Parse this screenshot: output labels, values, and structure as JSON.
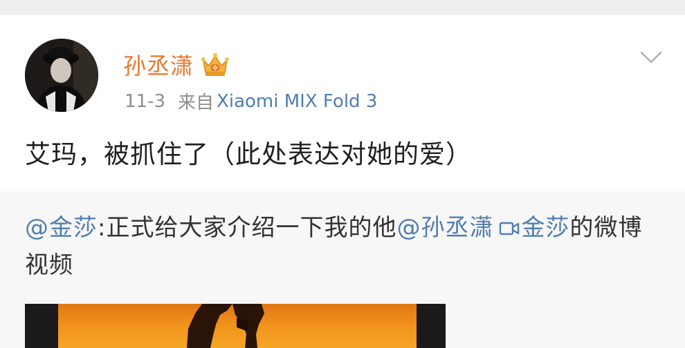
{
  "post": {
    "username": "孙丞潇",
    "time": "11-3",
    "from_label": "来自",
    "device": "Xiaomi MIX Fold 3",
    "text": "艾玛，被抓住了（此处表达对她的爱）"
  },
  "repost": {
    "author_mention": "@金莎",
    "text_before": ":正式给大家介绍一下我的他",
    "mention_2": "@孙丞潇",
    "video_link": "金莎",
    "text_after": "的微博视频"
  },
  "icons": {
    "badge": "crown-icon",
    "menu": "chevron-down-icon",
    "video": "video-camera-icon"
  },
  "colors": {
    "username": "#e8772e",
    "link": "#507daf",
    "meta": "#8c8c8c"
  }
}
